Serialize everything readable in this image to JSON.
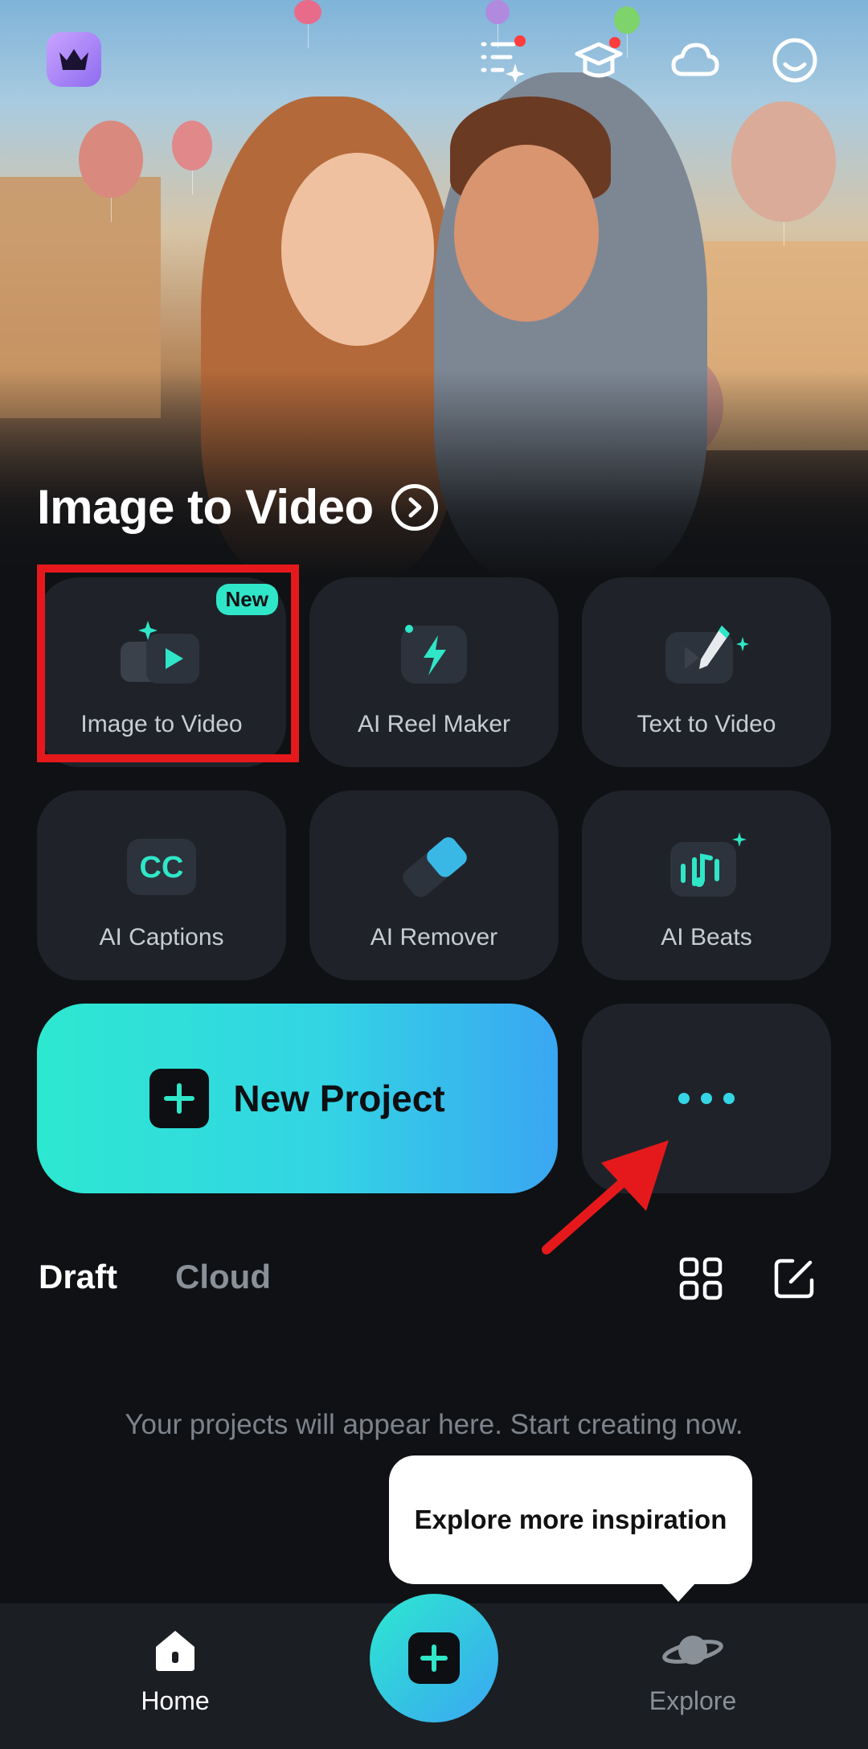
{
  "hero": {
    "title": "Image to Video",
    "icons": [
      "crown-icon",
      "task-list-icon",
      "graduation-cap-icon",
      "cloud-icon",
      "smiley-icon"
    ]
  },
  "tools": [
    {
      "label": "Image to Video",
      "icon": "image-to-video-icon",
      "badge": "New"
    },
    {
      "label": "AI Reel Maker",
      "icon": "lightning-icon"
    },
    {
      "label": "Text to Video",
      "icon": "pencil-video-icon"
    },
    {
      "label": "AI Captions",
      "icon": "cc-icon"
    },
    {
      "label": "AI Remover",
      "icon": "eraser-icon"
    },
    {
      "label": "AI Beats",
      "icon": "music-beats-icon"
    }
  ],
  "new_project": {
    "label": "New Project",
    "icon": "plus-icon"
  },
  "more": {
    "icon": "more-dots-icon"
  },
  "tabs": {
    "draft": "Draft",
    "cloud": "Cloud"
  },
  "empty_message": "Your projects will appear here. Start creating now.",
  "tooltip": "Explore more inspiration",
  "nav": {
    "home": "Home",
    "explore": "Explore"
  },
  "colors": {
    "accent": "#2de8d0",
    "accent2": "#3aa6f2",
    "highlight": "#e5191c",
    "tile_bg": "#1f2329",
    "bg": "#0f1114"
  }
}
